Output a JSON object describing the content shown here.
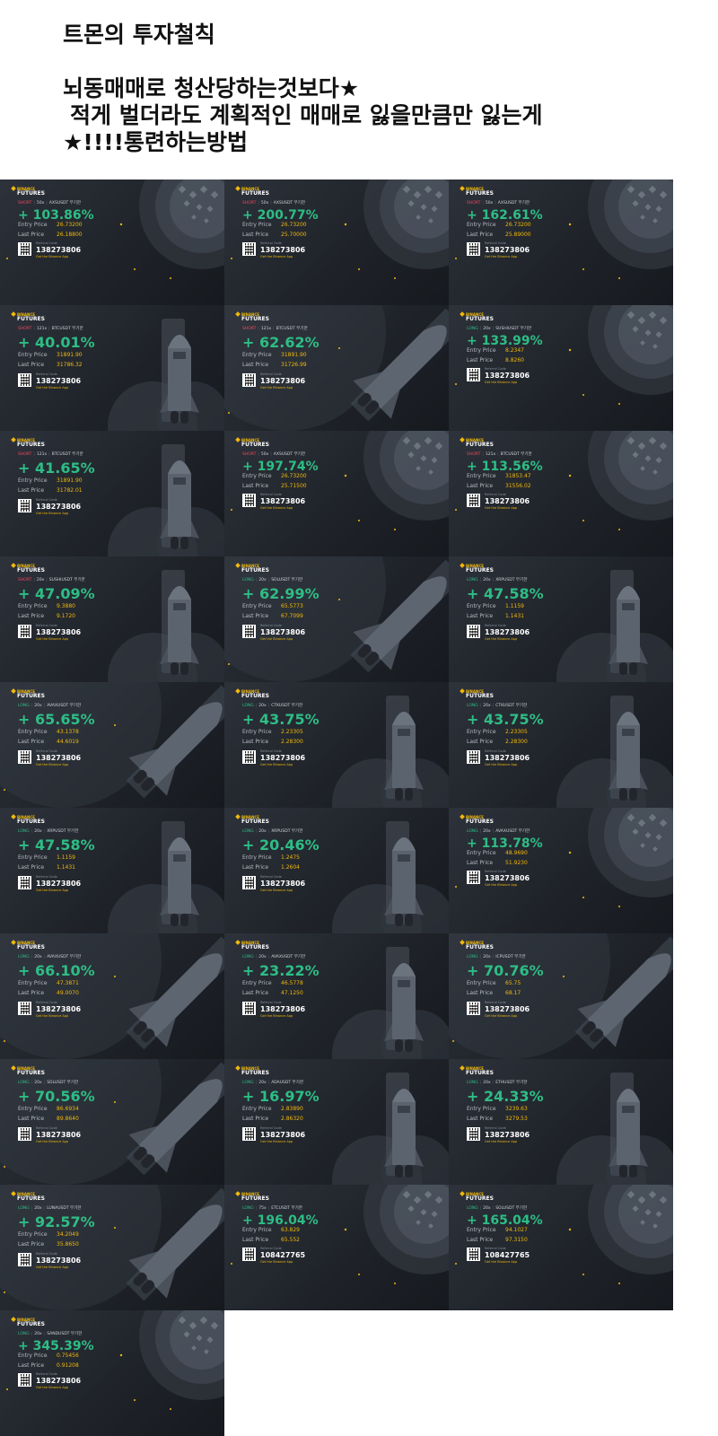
{
  "header": {
    "title": "트몬의 투자철칙",
    "line1": "뇌동매매로 청산당하는것보다★",
    "line2": "적게 벌더라도 계획적인 매매로 잃을만큼만 잃는게",
    "line3": "★!!!!통련하는방법"
  },
  "card_common": {
    "brand_top": "BINANCE",
    "brand_bottom": "FUTURES",
    "entry_label": "Entry Price",
    "last_label": "Last Price",
    "referral_label": "Referral Code",
    "app_text": "Get the Binance App"
  },
  "colors": {
    "profit": "#2ebd85",
    "short": "#f6465d",
    "long": "#2ebd85",
    "price": "#f0b90b",
    "brand": "#f0b90b"
  },
  "cards": [
    {
      "side": "SHORT",
      "lev": "50x",
      "pair": "AXSUSDT 무기한",
      "pnl": "+ 103.86%",
      "entry": "26.73200",
      "last": "26.18800",
      "code": "138273806",
      "art": "moon"
    },
    {
      "side": "SHORT",
      "lev": "50x",
      "pair": "AXSUSDT 무기한",
      "pnl": "+ 200.77%",
      "entry": "26.73200",
      "last": "25.70000",
      "code": "138273806",
      "art": "moon"
    },
    {
      "side": "SHORT",
      "lev": "50x",
      "pair": "AXSUSDT 무기한",
      "pnl": "+ 162.61%",
      "entry": "26.73200",
      "last": "25.89000",
      "code": "138273806",
      "art": "moon"
    },
    {
      "side": "SHORT",
      "lev": "121x",
      "pair": "BTCUSDT 무기한",
      "pnl": "+ 40.01%",
      "entry": "31891.90",
      "last": "31786.32",
      "code": "138273806",
      "art": "rocket"
    },
    {
      "side": "SHORT",
      "lev": "121x",
      "pair": "BTCUSDT 무기한",
      "pnl": "+ 62.62%",
      "entry": "31891.90",
      "last": "31726.99",
      "code": "138273806",
      "art": "shuttle"
    },
    {
      "side": "LONG",
      "lev": "20x",
      "pair": "SUSHIUSDT 무기한",
      "pnl": "+ 133.99%",
      "entry": "8.2347",
      "last": "8.8260",
      "code": "138273806",
      "art": "moon"
    },
    {
      "side": "SHORT",
      "lev": "121x",
      "pair": "BTCUSDT 무기한",
      "pnl": "+ 41.65%",
      "entry": "31891.90",
      "last": "31782.01",
      "code": "138273806",
      "art": "rocket"
    },
    {
      "side": "SHORT",
      "lev": "50x",
      "pair": "AXSUSDT 무기한",
      "pnl": "+ 197.74%",
      "entry": "26.73200",
      "last": "25.71500",
      "code": "138273806",
      "art": "moon"
    },
    {
      "side": "SHORT",
      "lev": "121x",
      "pair": "BTCUSDT 무기한",
      "pnl": "+ 113.56%",
      "entry": "31853.47",
      "last": "31556.02",
      "code": "138273806",
      "art": "moon"
    },
    {
      "side": "SHORT",
      "lev": "20x",
      "pair": "SUSHIUSDT 무기한",
      "pnl": "+ 47.09%",
      "entry": "9.3880",
      "last": "9.1720",
      "code": "138273806",
      "art": "rocket"
    },
    {
      "side": "LONG",
      "lev": "20x",
      "pair": "SOLUSDT 무기한",
      "pnl": "+ 62.99%",
      "entry": "65.5773",
      "last": "67.7099",
      "code": "138273806",
      "art": "shuttle"
    },
    {
      "side": "LONG",
      "lev": "20x",
      "pair": "XRPUSDT 무기한",
      "pnl": "+ 47.58%",
      "entry": "1.1159",
      "last": "1.1431",
      "code": "138273806",
      "art": "rocket"
    },
    {
      "side": "LONG",
      "lev": "20x",
      "pair": "AVAXUSDT 무기한",
      "pnl": "+ 65.65%",
      "entry": "43.1378",
      "last": "44.6019",
      "code": "138273806",
      "art": "shuttle"
    },
    {
      "side": "LONG",
      "lev": "20x",
      "pair": "CTKUSDT 무기한",
      "pnl": "+ 43.75%",
      "entry": "2.23305",
      "last": "2.28300",
      "code": "138273806",
      "art": "rocket"
    },
    {
      "side": "LONG",
      "lev": "20x",
      "pair": "CTKUSDT 무기한",
      "pnl": "+ 43.75%",
      "entry": "2.23305",
      "last": "2.28300",
      "code": "138273806",
      "art": "rocket"
    },
    {
      "side": "LONG",
      "lev": "20x",
      "pair": "XRPUSDT 무기한",
      "pnl": "+ 47.58%",
      "entry": "1.1159",
      "last": "1.1431",
      "code": "138273806",
      "art": "rocket"
    },
    {
      "side": "LONG",
      "lev": "20x",
      "pair": "XRPUSDT 무기한",
      "pnl": "+ 20.46%",
      "entry": "1.2475",
      "last": "1.2604",
      "code": "138273806",
      "art": "rocket"
    },
    {
      "side": "LONG",
      "lev": "20x",
      "pair": "AVAXUSDT 무기한",
      "pnl": "+ 113.78%",
      "entry": "48.9690",
      "last": "51.9230",
      "code": "138273806",
      "art": "moon"
    },
    {
      "side": "LONG",
      "lev": "20x",
      "pair": "AVAXUSDT 무기한",
      "pnl": "+ 66.10%",
      "entry": "47.3871",
      "last": "49.0070",
      "code": "138273806",
      "art": "shuttle"
    },
    {
      "side": "LONG",
      "lev": "20x",
      "pair": "AVAXUSDT 무기한",
      "pnl": "+ 23.22%",
      "entry": "46.5778",
      "last": "47.1250",
      "code": "138273806",
      "art": "rocket"
    },
    {
      "side": "LONG",
      "lev": "20x",
      "pair": "ICPUSDT 무기한",
      "pnl": "+ 70.76%",
      "entry": "65.75",
      "last": "68.17",
      "code": "138273806",
      "art": "shuttle"
    },
    {
      "side": "LONG",
      "lev": "20x",
      "pair": "SOLUSDT 무기한",
      "pnl": "+ 70.56%",
      "entry": "86.6934",
      "last": "89.8640",
      "code": "138273806",
      "art": "shuttle"
    },
    {
      "side": "LONG",
      "lev": "20x",
      "pair": "ADAUSDT 무기한",
      "pnl": "+ 16.97%",
      "entry": "2.83890",
      "last": "2.86320",
      "code": "138273806",
      "art": "rocket"
    },
    {
      "side": "LONG",
      "lev": "20x",
      "pair": "ETHUSDT 무기한",
      "pnl": "+ 24.33%",
      "entry": "3239.63",
      "last": "3279.53",
      "code": "138273806",
      "art": "rocket"
    },
    {
      "side": "LONG",
      "lev": "20x",
      "pair": "LUNAUSDT 무기한",
      "pnl": "+ 92.57%",
      "entry": "34.2049",
      "last": "35.8650",
      "code": "138273806",
      "art": "shuttle"
    },
    {
      "side": "LONG",
      "lev": "75x",
      "pair": "ETCUSDT 무기한",
      "pnl": "+ 196.04%",
      "entry": "63.829",
      "last": "65.552",
      "code": "108427765",
      "art": "moon"
    },
    {
      "side": "LONG",
      "lev": "20x",
      "pair": "SOLUSDT 무기한",
      "pnl": "+ 165.04%",
      "entry": "94.1027",
      "last": "97.3150",
      "code": "108427765",
      "art": "moon"
    },
    {
      "side": "LONG",
      "lev": "20x",
      "pair": "SANDUSDT 무기한",
      "pnl": "+ 345.39%",
      "entry": "0.75456",
      "last": "0.91208",
      "code": "138273806",
      "art": "moon"
    }
  ]
}
